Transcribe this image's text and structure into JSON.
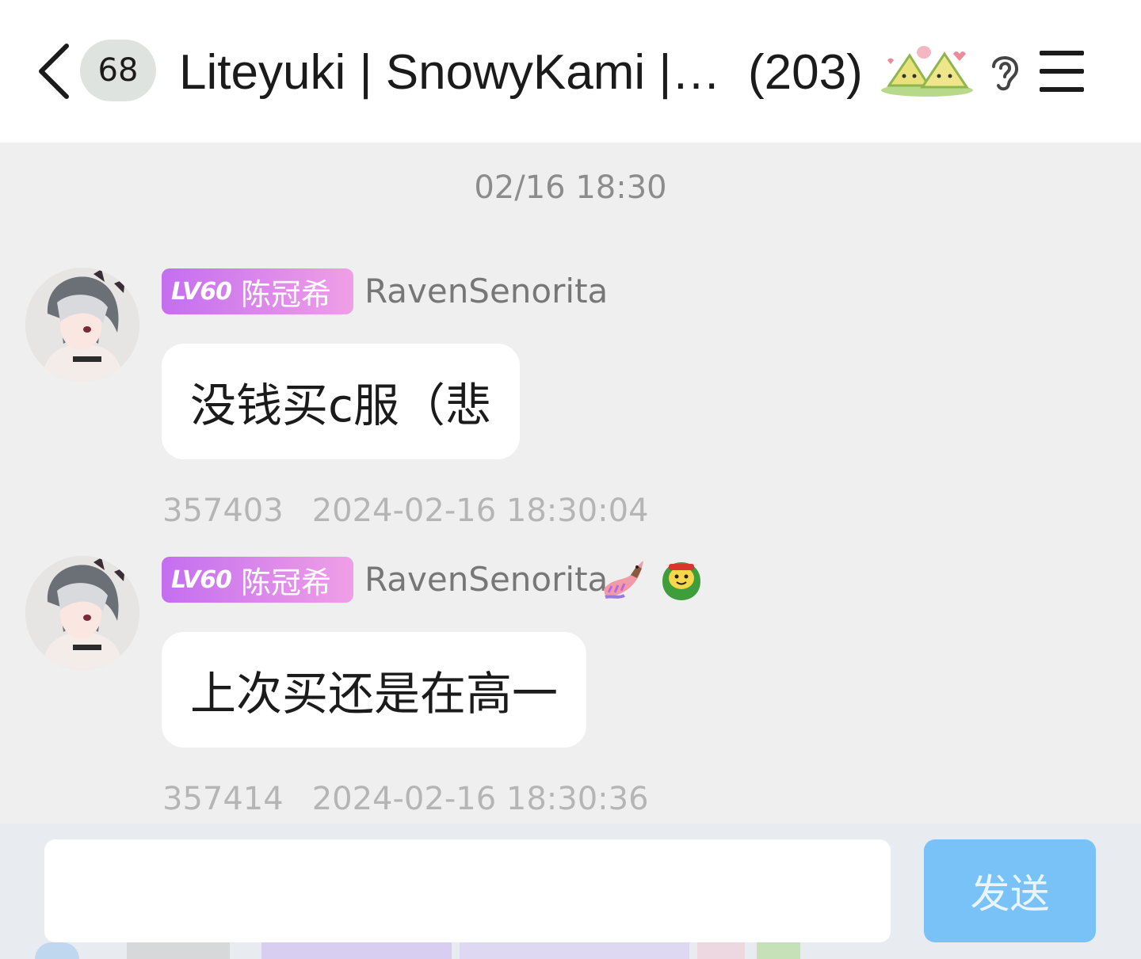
{
  "header": {
    "unread_count": "68",
    "title": "Liteyuki | SnowyKami |…",
    "member_count": "(203)"
  },
  "chat": {
    "date_divider": "02/16 18:30",
    "messages": [
      {
        "badge_level": "LV60",
        "badge_title": "陈冠希",
        "sender": "RavenSenorita",
        "text": "没钱买c服（悲",
        "msg_id": "357403",
        "timestamp": "2024-02-16 18:30:04"
      },
      {
        "badge_level": "LV60",
        "badge_title": "陈冠希",
        "sender": "RavenSenorita",
        "text": "上次买还是在高一",
        "msg_id": "357414",
        "timestamp": "2024-02-16 18:30:36",
        "name_icons": [
          "dragon-icon",
          "zongzi-face-icon"
        ]
      }
    ]
  },
  "composer": {
    "placeholder": "",
    "send_label": "发送"
  },
  "colors": {
    "badge_gradient_start": "#c46ef0",
    "badge_gradient_end": "#f09fe6",
    "send_button": "#78c2f7",
    "chat_background": "#efeff0"
  }
}
